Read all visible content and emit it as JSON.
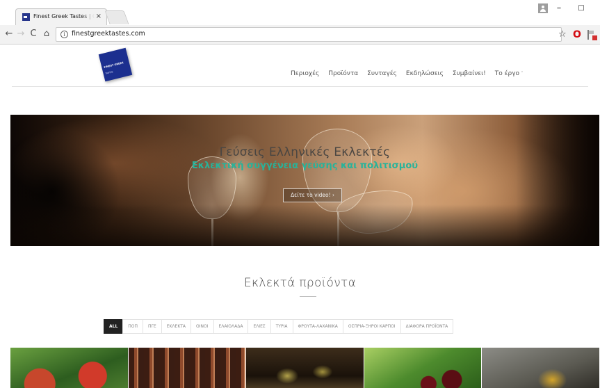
{
  "browser": {
    "tab_title": "Finest Greek Tastes | Greek",
    "tab_close": "×",
    "url": "finestgreektastes.com",
    "min_glyph": "–",
    "max_glyph": "□",
    "back_glyph": "←",
    "forward_glyph": "→",
    "reload_glyph": "C",
    "home_glyph": "⌂",
    "info_glyph": "i",
    "star_glyph": "☆",
    "opera_glyph": "O",
    "icons": [
      "favicon-icon",
      "profile-icon",
      "back-icon",
      "forward-icon",
      "reload-icon",
      "home-icon",
      "info-icon",
      "star-icon",
      "opera-icon",
      "extension-flag-icon"
    ]
  },
  "site": {
    "logo_line1": "FINEST GREEK",
    "logo_line2": "TASTES",
    "nav": [
      {
        "label": "Περιοχές"
      },
      {
        "label": "Προϊόντα"
      },
      {
        "label": "Συνταγές"
      },
      {
        "label": "Εκδηλώσεις"
      },
      {
        "label": "Συμβαίνει!"
      },
      {
        "label": "Το έργο"
      }
    ],
    "nav_caret": "˅"
  },
  "hero": {
    "title": "Γεύσεις Ελληνικές Εκλεκτές",
    "subtitle": "Εκλεκτική συγγένεια γεύσης και πολιτισμού",
    "button": "Δείτε το video! ›"
  },
  "featured": {
    "title": "Εκλεκτά προϊόντα",
    "filters": [
      "ALL",
      "ΠΟΠ",
      "ΠΓΕ",
      "ΕΚΛΕΚΤΑ",
      "ΟΙΝΟΙ",
      "ΕΛΑΙΟΛΑΔΑ",
      "ΕΛΙΕΣ",
      "ΤΥΡΙΑ",
      "ΦΡΟΥΤΑ-ΛΑΧΑΝΙΚΑ",
      "ΟΣΠΡΙΑ-ΞΗΡΟΙ ΚΑΡΠΟΙ",
      "ΔΙΑΦΟΡΑ ΠΡΟΪΟΝΤΑ"
    ],
    "active_filter": "ALL",
    "products": [
      "apples",
      "wines",
      "olives",
      "cherries",
      "jars"
    ]
  },
  "colors": {
    "accent": "#27b39a",
    "logo_blue": "#1c2f8f",
    "active_filter_bg": "#222222"
  }
}
